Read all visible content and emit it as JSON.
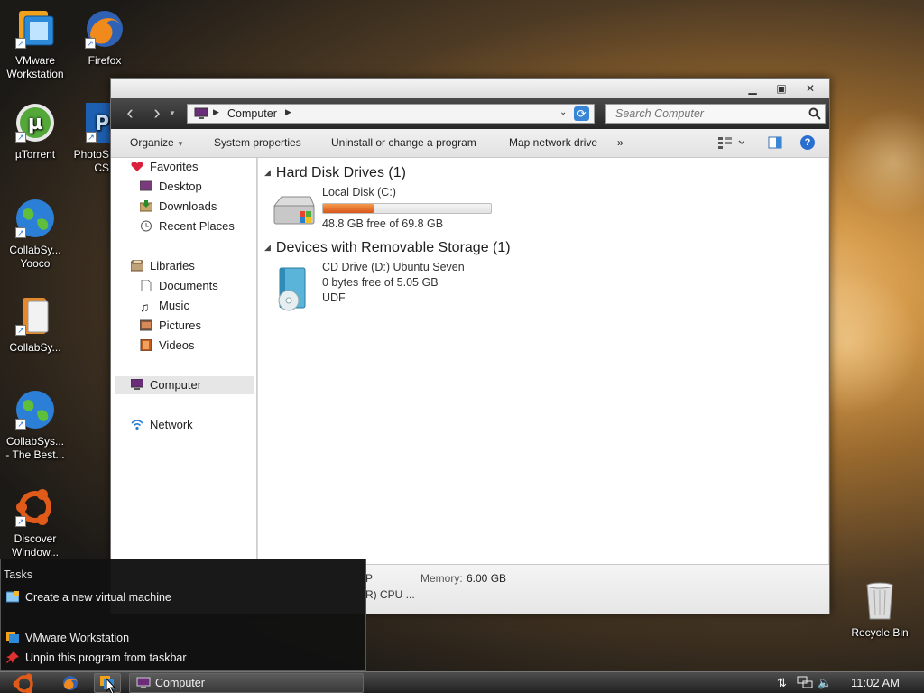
{
  "desktop_icons": [
    {
      "label": "VMware\nWorkstation",
      "icon": "vmware-icon"
    },
    {
      "label": "Firefox",
      "icon": "firefox-icon"
    },
    {
      "label": "µTorrent",
      "icon": "utorrent-icon"
    },
    {
      "label": "PhotoS\nCS",
      "icon": "photoshop-icon"
    },
    {
      "label": "CollabSy...\nYooco",
      "icon": "globe-icon"
    },
    {
      "label": "CollabSy...",
      "icon": "phone-icon"
    },
    {
      "label": "CollabSys...\n- The Best...",
      "icon": "globe-icon"
    },
    {
      "label": "Discover\nWindow...",
      "icon": "ubuntu-icon"
    },
    {
      "label": "Recycle Bin",
      "icon": "recycle-bin-icon"
    }
  ],
  "window": {
    "address": {
      "location": "Computer"
    },
    "search_placeholder": "Search Computer",
    "toolbar": {
      "organize": "Organize",
      "system_properties": "System properties",
      "uninstall": "Uninstall or change a program",
      "map_drive": "Map network drive",
      "more": "»"
    },
    "nav": {
      "favorites": "Favorites",
      "desktop": "Desktop",
      "downloads": "Downloads",
      "recent": "Recent Places",
      "libraries": "Libraries",
      "documents": "Documents",
      "music": "Music",
      "pictures": "Pictures",
      "videos": "Videos",
      "computer": "Computer",
      "network": "Network"
    },
    "groups": {
      "hdd": {
        "title": "Hard Disk Drives (1)",
        "drive_name": "Local Disk (C:)",
        "usage_fraction": 0.301,
        "free": "48.8 GB free of 69.8 GB"
      },
      "removable": {
        "title": "Devices with Removable Storage (1)",
        "drive_name": "CD Drive (D:) Ubuntu Seven",
        "free": "0 bytes free of 5.05 GB",
        "fs": "UDF"
      }
    },
    "details": {
      "memory_label": "Memory:",
      "memory_value": "6.00 GB",
      "left_fragment_1": "P",
      "left_fragment_2": "R) CPU ..."
    }
  },
  "jumplist": {
    "tasks_header": "Tasks",
    "create_vm": "Create a new virtual machine",
    "app_name": "VMware Workstation",
    "unpin": "Unpin this program from taskbar"
  },
  "taskbar": {
    "active_window": "Computer",
    "clock": "11:02 AM"
  },
  "colors": {
    "disk_bar": "#e2601c",
    "selected_nav": "#e6e6e6"
  }
}
